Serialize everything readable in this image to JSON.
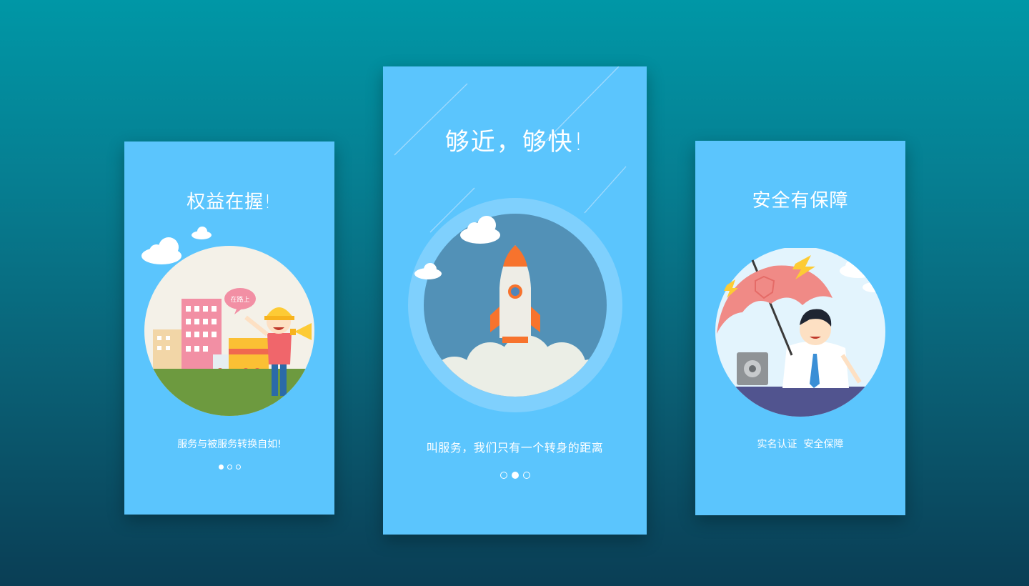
{
  "cards": [
    {
      "title": "权益在握!",
      "subtitle": "服务与被服务转换自如!",
      "speech_bubble": "在路上",
      "dots": [
        true,
        false,
        false
      ]
    },
    {
      "title": "够近，够快!",
      "subtitle": "叫服务，我们只有一个转身的距离",
      "dots": [
        false,
        true,
        false
      ]
    },
    {
      "title": "安全有保障",
      "subtitle": "实名认证  安全保障"
    }
  ],
  "colors": {
    "card_bg": "#5bc5fd",
    "rocket_circle": "#5291b7",
    "umbrella": "#f08a86",
    "helmet": "#fdcb35"
  },
  "icons": [
    "cloud-icon",
    "rocket-icon",
    "umbrella-icon",
    "safe-icon",
    "megaphone-icon",
    "lightning-icon"
  ]
}
